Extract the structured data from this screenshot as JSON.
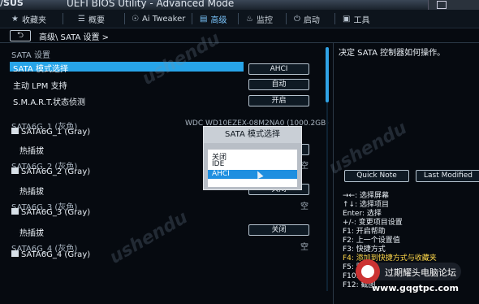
{
  "titlebar": {
    "brand": "/SUS",
    "title": "UEFI BIOS Utility - Advanced Mode"
  },
  "menubar": {
    "items": [
      {
        "icon": "★",
        "label": "收藏夹"
      },
      {
        "icon": "☰",
        "label": "概要"
      },
      {
        "icon": "☉",
        "label": "Ai Tweaker"
      },
      {
        "icon": "▤",
        "label": "高级"
      },
      {
        "icon": "♨",
        "label": "监控"
      },
      {
        "icon": "⏻",
        "label": "启动"
      },
      {
        "icon": "▣",
        "label": "工具"
      }
    ],
    "active": "高级"
  },
  "breadcrumb": {
    "back": "⮌",
    "path": "高级\\ SATA 设置 >"
  },
  "settings": {
    "section": "SATA 设置",
    "mode_label": "SATA 模式选择",
    "mode_value": "AHCI",
    "lpm_label": "主动 LPM 支持",
    "lpm_value": "自动",
    "smart_label": "S.M.A.R.T.状态侦测",
    "smart_value": "开启",
    "ports": [
      {
        "title": "SATA6G_1 (灰色)",
        "name": "SATA6G_1 (Gray)",
        "device": "WDC WD10EZEX-08M2NA0 (1000.2GB)",
        "hotplug_label": "热插拔",
        "hotplug_value": "",
        "status": ""
      },
      {
        "title": "SATA6G_2 (灰色)",
        "name": "SATA6G_2 (Gray)",
        "device": "",
        "hotplug_label": "热插拔",
        "hotplug_value": "关闭",
        "status": "空"
      },
      {
        "title": "SATA6G_3 (灰色)",
        "name": "SATA6G_3 (Gray)",
        "device": "",
        "hotplug_label": "热插拔",
        "hotplug_value": "关闭",
        "status": "空"
      },
      {
        "title": "SATA6G_4 (灰色)",
        "name": "SATA6G_4 (Gray)",
        "device": "",
        "hotplug_label": "",
        "hotplug_value": "",
        "status": "空"
      }
    ],
    "port1_status": "空"
  },
  "popup": {
    "title": "SATA 模式选择",
    "options": [
      "关闭",
      "IDE",
      "AHCI"
    ],
    "selected": "AHCI"
  },
  "right": {
    "description": "决定 SATA 控制器如何操作。",
    "quick_note": "Quick Note",
    "last_modified": "Last Modified",
    "help": [
      "→←: 选择屏幕",
      "↑↓: 选择项目",
      "Enter: 选择",
      "+/-: 变更项目设置",
      "F1: 开启帮助",
      "F2: 上一个设置值",
      "F3: 快捷方式",
      "F4: 添加到快捷方式与收藏夹",
      "F5: 默认设置",
      "F10: 保存",
      "F12: 截图"
    ]
  },
  "watermark": {
    "forum": "过期耀头电脑论坛",
    "url": "www.gqgtpc.com",
    "brand": "ushendu"
  }
}
